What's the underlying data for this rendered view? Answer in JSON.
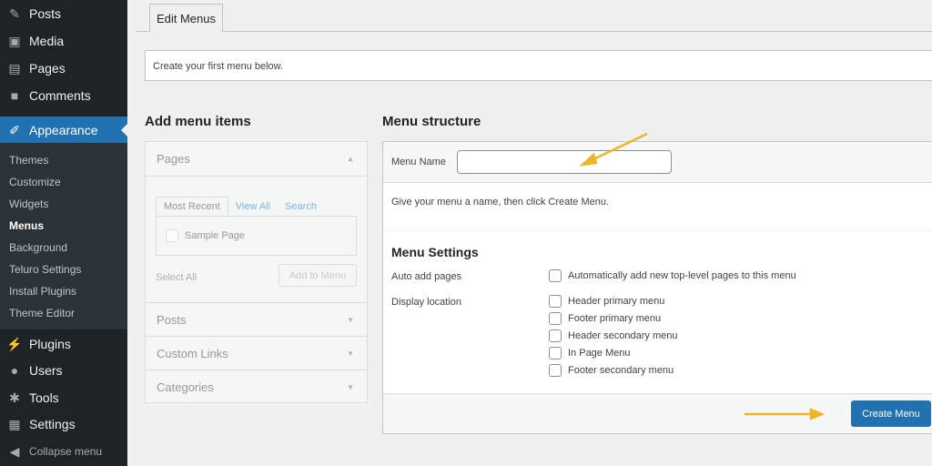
{
  "sidebar": {
    "top": [
      {
        "label": "Posts",
        "icon": "pin-icon"
      },
      {
        "label": "Media",
        "icon": "media-icon"
      },
      {
        "label": "Pages",
        "icon": "pages-icon"
      },
      {
        "label": "Comments",
        "icon": "comment-icon"
      }
    ],
    "active": "Appearance",
    "submenu": [
      "Themes",
      "Customize",
      "Widgets",
      "Menus",
      "Background",
      "Teluro Settings",
      "Install Plugins",
      "Theme Editor"
    ],
    "bottom": [
      "Plugins",
      "Users",
      "Tools",
      "Settings"
    ],
    "collapse": "Collapse menu"
  },
  "tab": "Edit Menus",
  "notice": "Create your first menu below.",
  "left": {
    "heading": "Add menu items",
    "pages": "Pages",
    "tabs": [
      "Most Recent",
      "View All",
      "Search"
    ],
    "item": "Sample Page",
    "select_all": "Select All",
    "add": "Add to Menu",
    "sections": [
      "Posts",
      "Custom Links",
      "Categories"
    ]
  },
  "right": {
    "heading": "Menu structure",
    "name_label": "Menu Name",
    "name_value": "",
    "hint": "Give your menu a name, then click Create Menu.",
    "settings": "Menu Settings",
    "auto_label": "Auto add pages",
    "auto_text": "Automatically add new top-level pages to this menu",
    "display_label": "Display location",
    "locations": [
      "Header primary menu",
      "Footer primary menu",
      "Header secondary menu",
      "In Page Menu",
      "Footer secondary menu"
    ],
    "create": "Create Menu"
  },
  "colors": {
    "accent": "#2271b1",
    "arrow": "#f0b429"
  }
}
